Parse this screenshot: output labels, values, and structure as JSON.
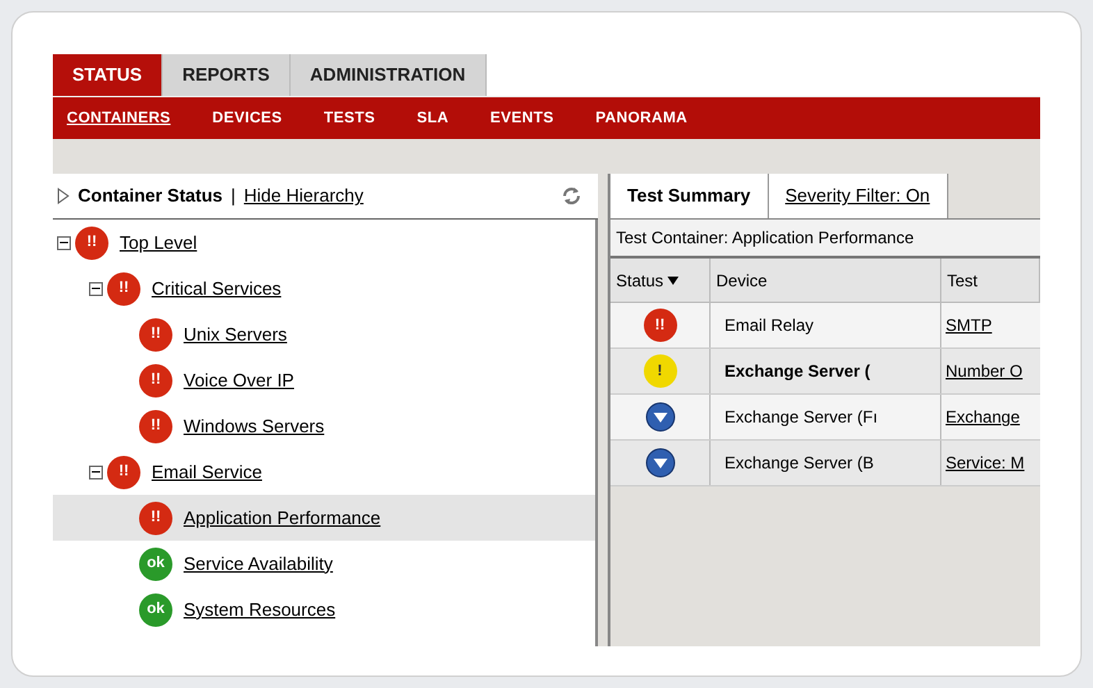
{
  "main_tabs": [
    {
      "label": "STATUS",
      "selected": true
    },
    {
      "label": "REPORTS",
      "selected": false
    },
    {
      "label": "ADMINISTRATION",
      "selected": false
    }
  ],
  "sub_tabs": [
    {
      "label": "CONTAINERS",
      "selected": true
    },
    {
      "label": "DEVICES",
      "selected": false
    },
    {
      "label": "TESTS",
      "selected": false
    },
    {
      "label": "SLA",
      "selected": false
    },
    {
      "label": "EVENTS",
      "selected": false
    },
    {
      "label": "PANORAMA",
      "selected": false
    }
  ],
  "tree_panel": {
    "title": "Container Status",
    "separator": "|",
    "link": "Hide Hierarchy"
  },
  "tree": [
    {
      "label": "Top Level",
      "kind": "critical",
      "badge": "!!",
      "expanded": true,
      "selected": false,
      "children": [
        {
          "label": "Critical Services",
          "kind": "critical",
          "badge": "!!",
          "expanded": true,
          "selected": false,
          "children": [
            {
              "label": "Unix Servers",
              "kind": "critical",
              "badge": "!!",
              "selected": false
            },
            {
              "label": "Voice Over IP",
              "kind": "critical",
              "badge": "!!",
              "selected": false
            },
            {
              "label": "Windows Servers",
              "kind": "critical",
              "badge": "!!",
              "selected": false
            }
          ]
        },
        {
          "label": "Email Service",
          "kind": "critical",
          "badge": "!!",
          "expanded": true,
          "selected": false,
          "children": [
            {
              "label": "Application Performance",
              "kind": "critical",
              "badge": "!!",
              "selected": true
            },
            {
              "label": "Service Availability",
              "kind": "ok",
              "badge": "ok",
              "selected": false
            },
            {
              "label": "System Resources",
              "kind": "ok",
              "badge": "ok",
              "selected": false
            }
          ]
        }
      ]
    }
  ],
  "right_tabs": [
    {
      "label": "Test Summary",
      "selected": true
    },
    {
      "label": "Severity Filter: On",
      "selected": false
    }
  ],
  "container_label": "Test Container: Application Performance",
  "table": {
    "columns": [
      "Status",
      "Device",
      "Test"
    ],
    "rows": [
      {
        "kind": "critical",
        "badge": "!!",
        "device": "Email Relay",
        "test": "SMTP",
        "bold": false
      },
      {
        "kind": "warning",
        "badge": "!",
        "device": "Exchange Server (",
        "test": "Number O",
        "bold": true
      },
      {
        "kind": "info",
        "device": "Exchange Server (Fı",
        "test": "Exchange",
        "bold": false
      },
      {
        "kind": "info",
        "device": "Exchange Server (B",
        "test": "Service: M",
        "bold": false
      }
    ]
  }
}
